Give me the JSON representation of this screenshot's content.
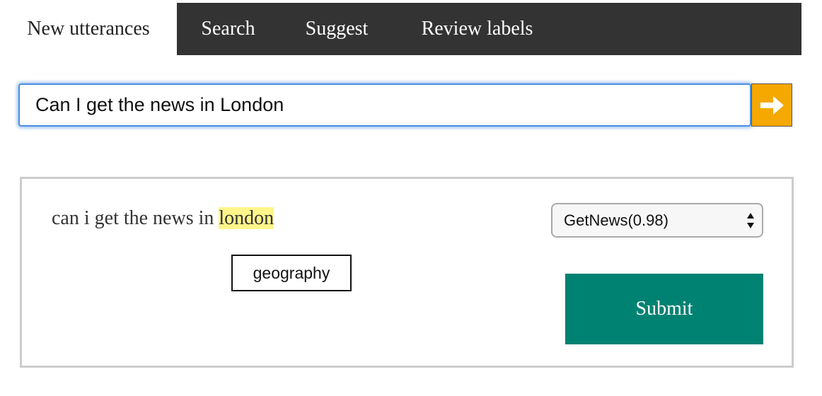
{
  "tabs": [
    {
      "label": "New utterances",
      "active": true
    },
    {
      "label": "Search",
      "active": false
    },
    {
      "label": "Suggest",
      "active": false
    },
    {
      "label": "Review labels",
      "active": false
    }
  ],
  "query": {
    "value": "Can I get the news in London",
    "go_icon": "arrow-right-icon"
  },
  "result": {
    "utterance_prefix": "can i get the news in ",
    "utterance_highlight": "london",
    "entity_label": "geography",
    "intent_selected": "GetNews(0.98)",
    "submit_label": "Submit"
  },
  "colors": {
    "tab_bar": "#333333",
    "go_button": "#f5a800",
    "highlight": "#fff58a",
    "submit": "#008272",
    "input_focus": "#4a90e2"
  }
}
